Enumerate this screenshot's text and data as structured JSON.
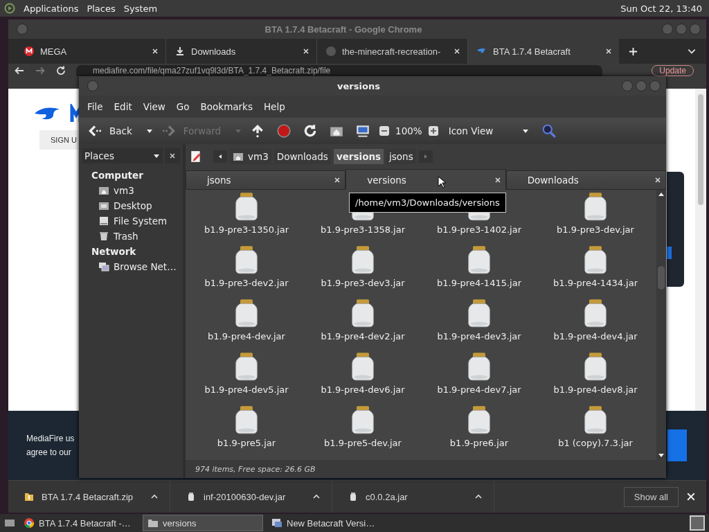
{
  "top_panel": {
    "menus": [
      "Applications",
      "Places",
      "System"
    ],
    "clock": "Sun Oct 22, 13:40"
  },
  "chrome": {
    "title": "BTA 1.7.4 Betacraft - Google Chrome",
    "tabs": [
      {
        "label": "MEGA",
        "kind": "mega",
        "selected": false
      },
      {
        "label": "Downloads",
        "kind": "download",
        "selected": false
      },
      {
        "label": "the-minecraft-recreation-",
        "kind": "github",
        "selected": false
      },
      {
        "label": "BTA 1.7.4 Betacraft",
        "kind": "mediafire",
        "selected": true
      }
    ],
    "url": "mediafire.com/file/qma27zuf1vq9l3d/BTA_1.7.4_Betacraft.zip/file",
    "update_button": "Update",
    "page": {
      "sign_up": "SIGN U",
      "footer_lines": [
        "MediaFire us",
        "agree to our"
      ]
    },
    "downloads": [
      {
        "name": "BTA 1.7.4 Betacraft.zip",
        "kind": "zip"
      },
      {
        "name": "inf-20100630-dev.jar",
        "kind": "jar"
      },
      {
        "name": "c0.0.2a.jar",
        "kind": "jar"
      }
    ],
    "show_all": "Show all"
  },
  "file_manager": {
    "title": "versions",
    "menu": [
      "File",
      "Edit",
      "View",
      "Go",
      "Bookmarks",
      "Help"
    ],
    "toolbar": {
      "back": "Back",
      "forward": "Forward",
      "forward_disabled": true,
      "zoom": "100%",
      "view": "Icon View"
    },
    "sidebar": {
      "header": "Places",
      "sections": [
        {
          "title": "Computer",
          "items": [
            {
              "label": "vm3",
              "kind": "home"
            },
            {
              "label": "Desktop",
              "kind": "desktop"
            },
            {
              "label": "File System",
              "kind": "drive"
            },
            {
              "label": "Trash",
              "kind": "trash"
            }
          ]
        },
        {
          "title": "Network",
          "items": [
            {
              "label": "Browse Net…",
              "kind": "network"
            }
          ]
        }
      ]
    },
    "path": [
      {
        "label": "vm3",
        "selected": false
      },
      {
        "label": "Downloads",
        "selected": false
      },
      {
        "label": "versions",
        "selected": true
      },
      {
        "label": "jsons",
        "selected": false
      }
    ],
    "tabs": [
      {
        "label": "jsons",
        "selected": false
      },
      {
        "label": "versions",
        "selected": true
      },
      {
        "label": "Downloads",
        "selected": false
      }
    ],
    "tooltip": "/home/vm3/Downloads/versions",
    "files": [
      "b1.9-pre3-1350.jar",
      "b1.9-pre3-1358.jar",
      "b1.9-pre3-1402.jar",
      "b1.9-pre3-dev.jar",
      "b1.9-pre3-dev2.jar",
      "b1.9-pre3-dev3.jar",
      "b1.9-pre4-1415.jar",
      "b1.9-pre4-1434.jar",
      "b1.9-pre4-dev.jar",
      "b1.9-pre4-dev2.jar",
      "b1.9-pre4-dev3.jar",
      "b1.9-pre4-dev4.jar",
      "b1.9-pre4-dev5.jar",
      "b1.9-pre4-dev6.jar",
      "b1.9-pre4-dev7.jar",
      "b1.9-pre4-dev8.jar",
      "b1.9-pre5.jar",
      "b1.9-pre5-dev.jar",
      "b1.9-pre6.jar",
      "b1 (copy).7.3.jar"
    ],
    "status": "974 items, Free space: 26.6 GB"
  },
  "taskbar": {
    "items": [
      {
        "label": "BTA 1.7.4 Betacraft -…",
        "kind": "chrome",
        "selected": false
      },
      {
        "label": "versions",
        "kind": "folder",
        "selected": true
      },
      {
        "label": "New Betacraft Versi…",
        "kind": "app",
        "selected": false
      }
    ]
  }
}
